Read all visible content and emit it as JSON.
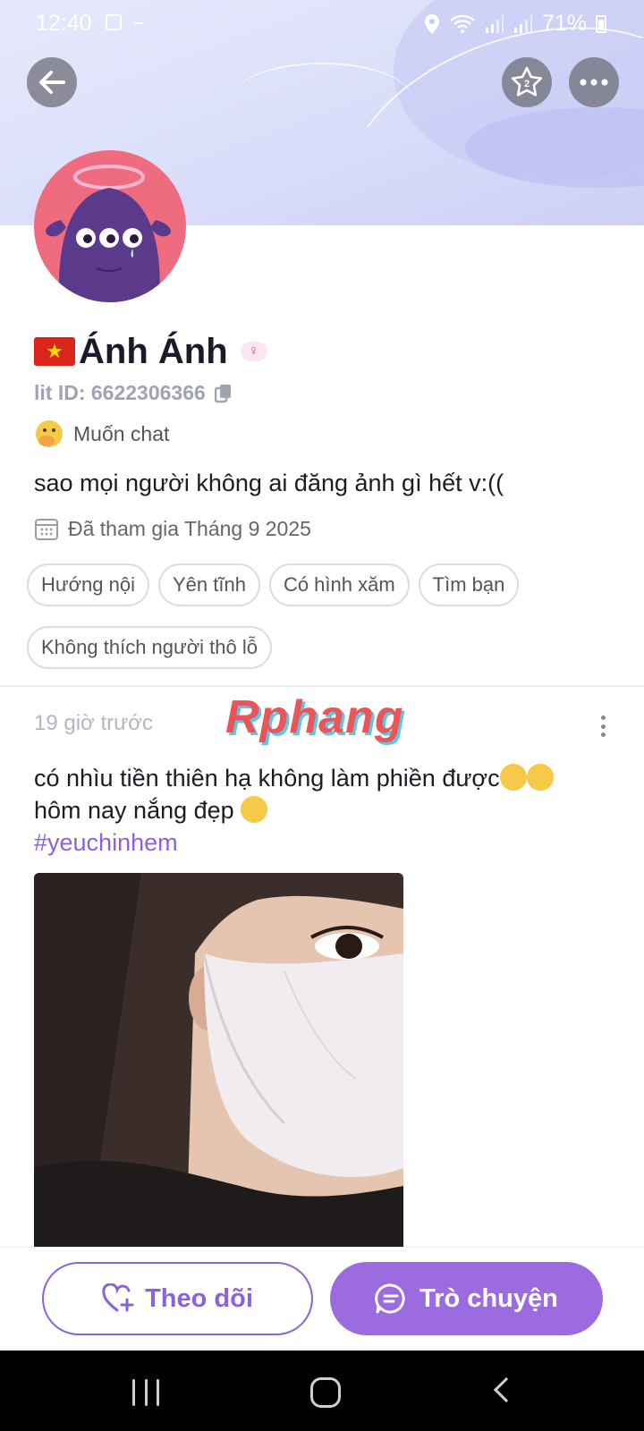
{
  "status_bar": {
    "time": "12:40",
    "battery": "71%"
  },
  "profile": {
    "name": "Ánh Ánh",
    "country_flag": "Vietnam",
    "gender_symbol": "♀",
    "lit_id": "lit ID: 6622306366",
    "mood": "Muốn chat",
    "bio": "sao mọi người không ai đăng ảnh gì hết v:((",
    "joined": "Đã tham gia Tháng 9 2025",
    "tags": [
      "Hướng nội",
      "Yên tĩnh",
      "Có hình xăm",
      "Tìm bạn",
      "Không thích người thô lỗ"
    ]
  },
  "post": {
    "time": "19 giờ trước",
    "watermark": "Rphang",
    "line1": "có nhìu tiền thiên hạ không làm phiền được",
    "line2": "hôm nay nắng đẹp",
    "hashtag": "#yeuchinhem"
  },
  "actions": {
    "follow_label": "Theo dõi",
    "chat_label": "Trò chuyện"
  },
  "colors": {
    "accent": "#9c6be0",
    "banner": "#dde0fa",
    "avatar_bg": "#ef6c80"
  }
}
